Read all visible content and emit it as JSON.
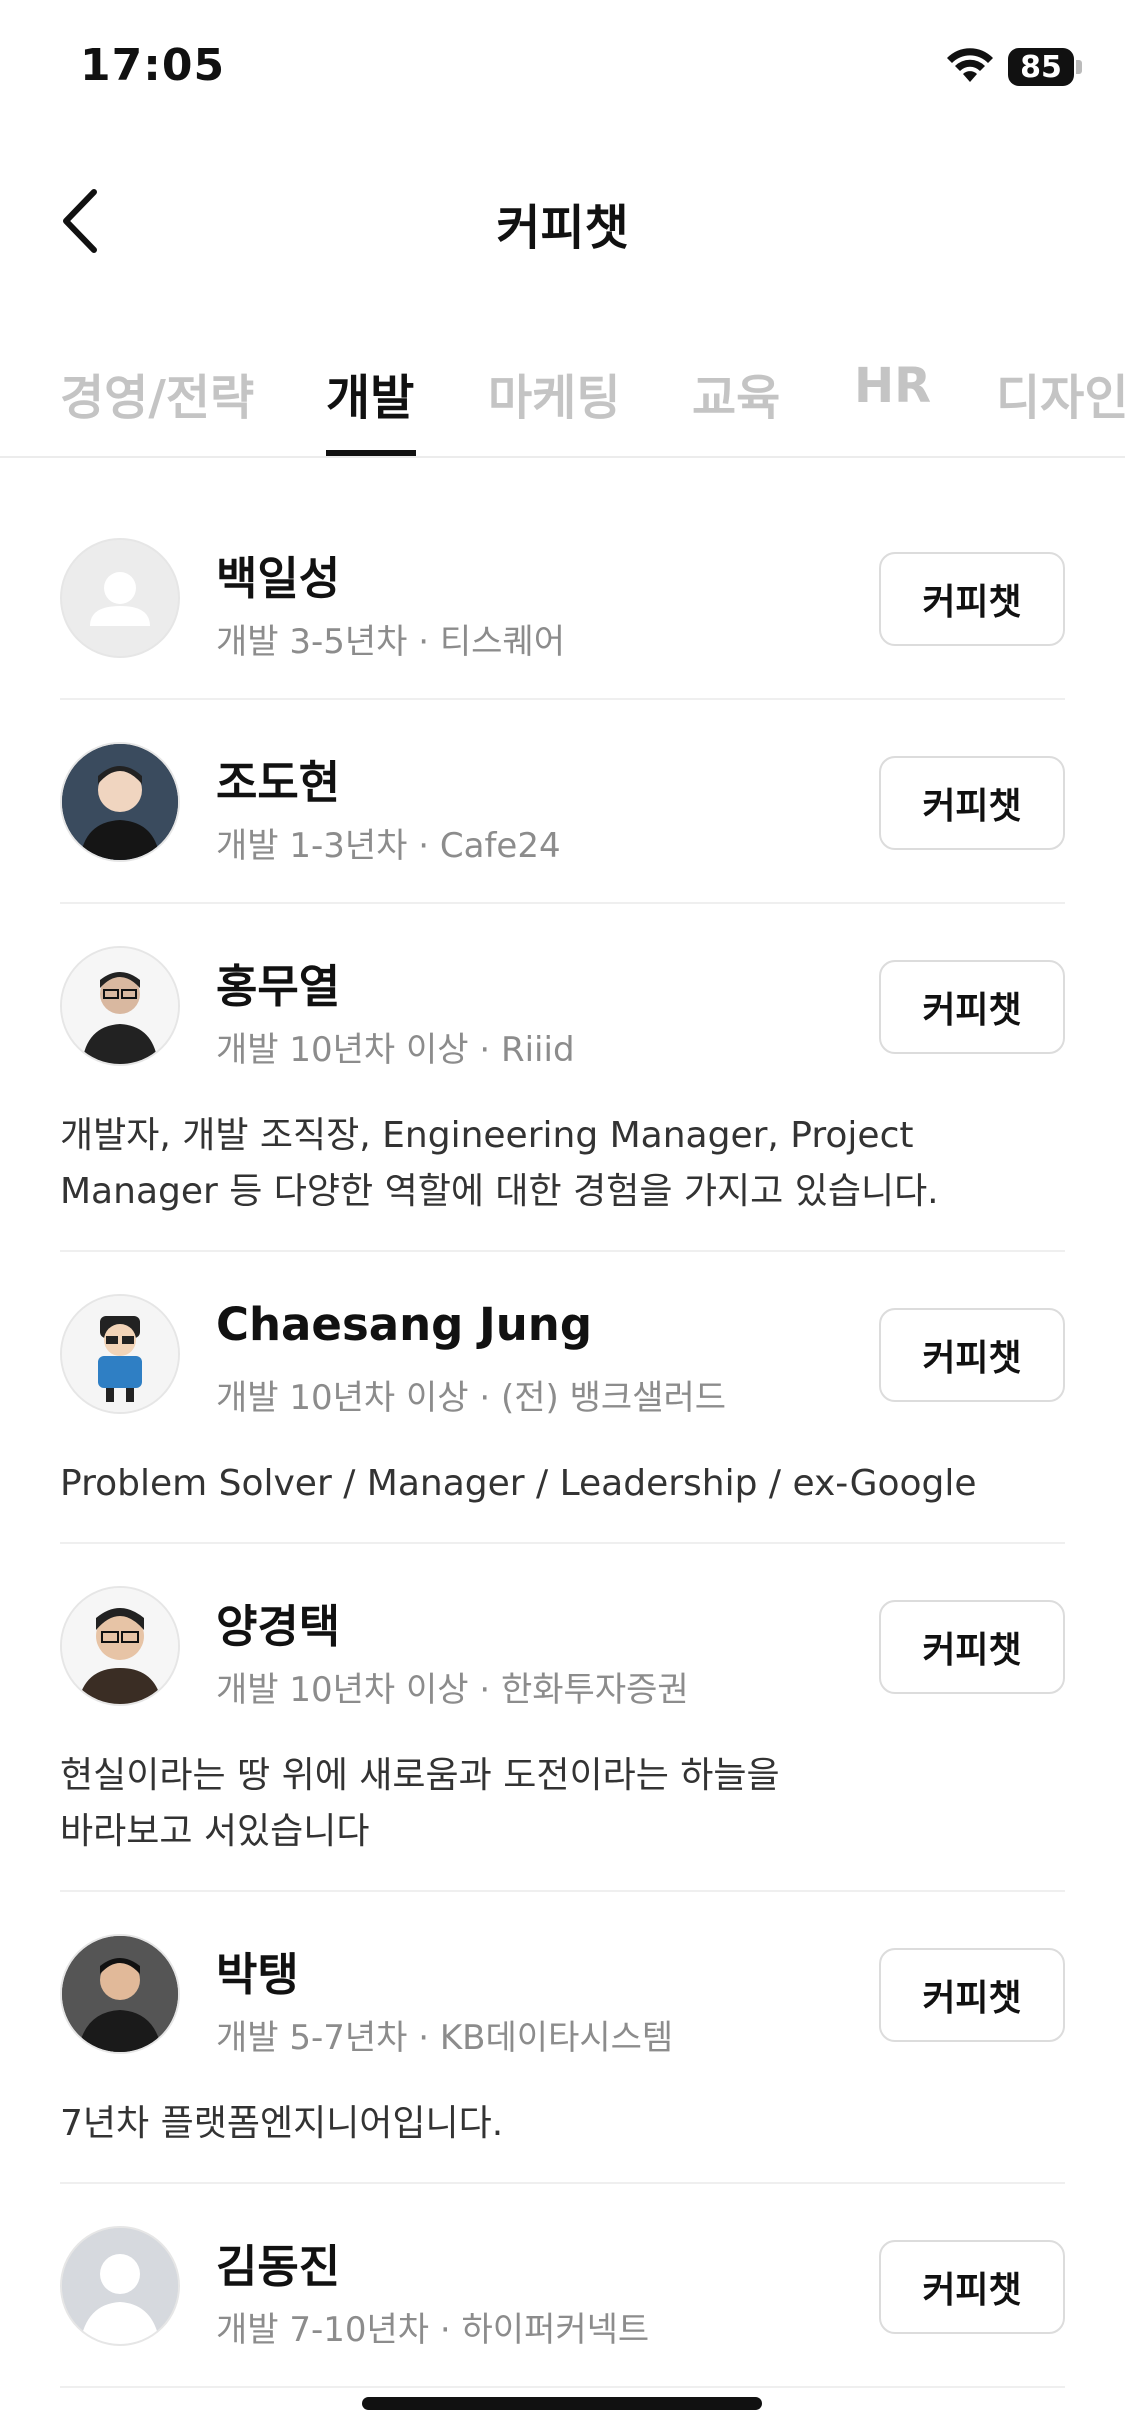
{
  "status": {
    "time": "17:05",
    "battery": "85"
  },
  "nav": {
    "title": "커피챗"
  },
  "tabs": [
    {
      "label": "경영/전략"
    },
    {
      "label": "개발"
    },
    {
      "label": "마케팅"
    },
    {
      "label": "교육"
    },
    {
      "label": "HR"
    },
    {
      "label": "디자인"
    }
  ],
  "active_tab": "개발",
  "people": [
    {
      "name": "백일성",
      "meta": "개발 3-5년차 · 티스퀘어",
      "button": "커피챗",
      "description": ""
    },
    {
      "name": "조도현",
      "meta": "개발 1-3년차 · Cafe24",
      "button": "커피챗",
      "description": ""
    },
    {
      "name": "홍무열",
      "meta": "개발 10년차 이상 · Riiid",
      "button": "커피챗",
      "description_lines": [
        "개발자, 개발 조직장, Engineering Manager, Project",
        "Manager 등 다양한 역할에 대한 경험을 가지고 있습니다."
      ]
    },
    {
      "name": "Chaesang Jung",
      "meta": "개발 10년차 이상 · (전) 뱅크샐러드",
      "button": "커피챗",
      "description_lines": [
        "Problem Solver / Manager / Leadership / ex-Google"
      ]
    },
    {
      "name": "양경택",
      "meta": "개발 10년차 이상 · 한화투자증권",
      "button": "커피챗",
      "description_lines": [
        "현실이라는 땅 위에 새로움과 도전이라는 하늘을",
        "바라보고 서있습니다"
      ]
    },
    {
      "name": "박탱",
      "meta": "개발 5-7년차 · KB데이타시스템",
      "button": "커피챗",
      "description_lines": [
        "7년차 플랫폼엔지니어입니다."
      ]
    },
    {
      "name": "김동진",
      "meta": "개발 7-10년차 · 하이퍼커넥트",
      "button": "커피챗",
      "description": ""
    }
  ],
  "colors": {
    "accent": "#111111",
    "muted": "#8c8c8c",
    "tab_inactive": "#c4c4c4",
    "divider": "#efefef"
  }
}
